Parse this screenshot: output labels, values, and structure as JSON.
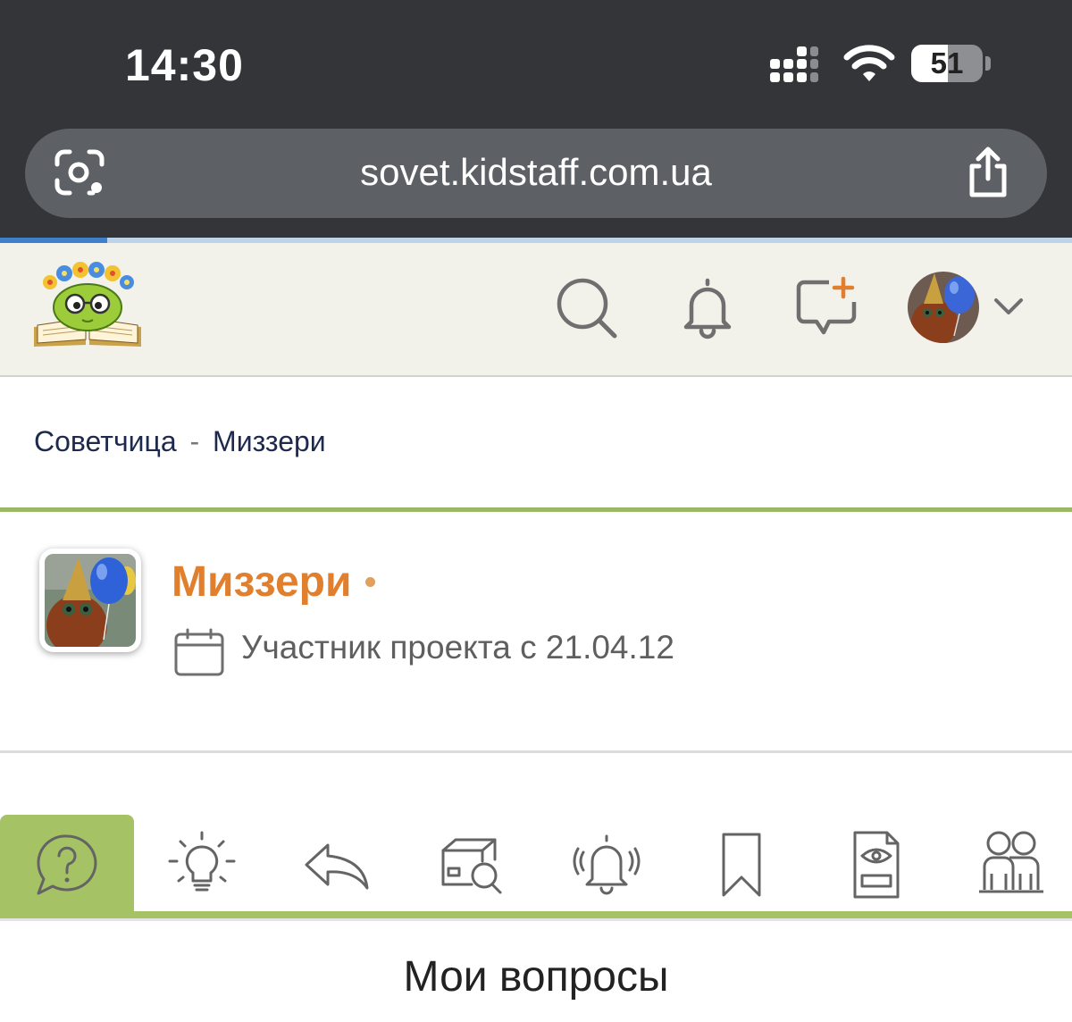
{
  "status_bar": {
    "time": "14:30",
    "battery_level": "51",
    "battery_fraction": 0.51,
    "icons": [
      "cellular-signal-icon",
      "wifi-icon",
      "battery-icon"
    ]
  },
  "browser": {
    "url": "sovet.kidstaff.com.ua",
    "load_progress": 0.1,
    "icons": [
      "camera-search-icon",
      "share-icon"
    ]
  },
  "header": {
    "logo": "kidstaff-sovet-logo",
    "icons": [
      "search-icon",
      "bell-icon",
      "new-message-icon",
      "user-avatar",
      "chevron-down-icon"
    ]
  },
  "breadcrumb": {
    "site": "Советчица",
    "separator": "-",
    "page": "Миззери"
  },
  "profile": {
    "name": "Миззери",
    "online_dot": "•",
    "member_since": "Участник проекта с 21.04.12"
  },
  "tabs": [
    {
      "icon": "question-bubble-icon",
      "active": true
    },
    {
      "icon": "lightbulb-icon",
      "active": false
    },
    {
      "icon": "reply-arrow-icon",
      "active": false
    },
    {
      "icon": "box-search-icon",
      "active": false
    },
    {
      "icon": "ringing-bell-icon",
      "active": false
    },
    {
      "icon": "bookmark-icon",
      "active": false
    },
    {
      "icon": "document-eye-icon",
      "active": false
    },
    {
      "icon": "people-icon",
      "active": false
    }
  ],
  "section": {
    "title": "Мои вопросы"
  },
  "colors": {
    "status_bar_bg": "#333539",
    "url_pill_bg": "#5d6065",
    "header_bg": "#f2f1ea",
    "accent_green": "#a5c264",
    "name_orange": "#e07f2e",
    "breadcrumb_navy": "#1d2a4d",
    "progress_blue": "#3f7fcb"
  }
}
